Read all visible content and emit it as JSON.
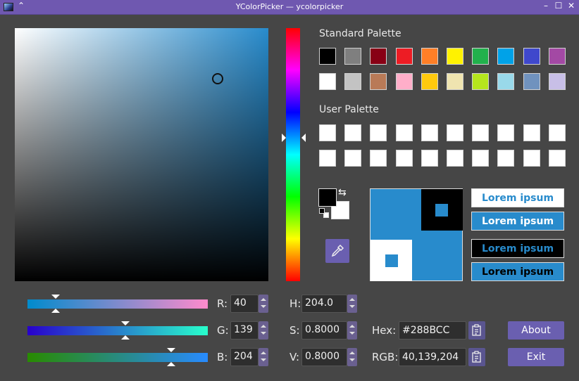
{
  "window": {
    "title": "YColorPicker — ycolorpicker"
  },
  "colors": {
    "current": "#288BCC",
    "accent": "#6a5fb0",
    "titlebar": "#6f58b0"
  },
  "standard_palette": {
    "label": "Standard Palette",
    "swatches": [
      "#000000",
      "#7f7f7f",
      "#880015",
      "#ed1c24",
      "#ff7f27",
      "#fff200",
      "#22b14c",
      "#00a2e8",
      "#3f48cc",
      "#a349a4",
      "#ffffff",
      "#c3c3c3",
      "#b97a57",
      "#ffaec9",
      "#ffc90e",
      "#efe4b0",
      "#b5e61d",
      "#99d9ea",
      "#7092be",
      "#c8bfe7"
    ]
  },
  "user_palette": {
    "label": "User Palette"
  },
  "preview": {
    "lorem": [
      {
        "text": "Lorem ipsum",
        "fg": "#288BCC",
        "bg": "#ffffff"
      },
      {
        "text": "Lorem ipsum",
        "fg": "#ffffff",
        "bg": "#288BCC"
      },
      {
        "text": "Lorem ipsum",
        "fg": "#288BCC",
        "bg": "#000000"
      },
      {
        "text": "Lorem ipsum",
        "fg": "#000000",
        "bg": "#288BCC"
      }
    ]
  },
  "rgb": {
    "r": {
      "label": "R:",
      "value": "40"
    },
    "g": {
      "label": "G:",
      "value": "139"
    },
    "b": {
      "label": "B:",
      "value": "204"
    }
  },
  "hsv": {
    "h": {
      "label": "H:",
      "value": "204.0"
    },
    "s": {
      "label": "S:",
      "value": "0.8000"
    },
    "v": {
      "label": "V:",
      "value": "0.8000"
    }
  },
  "hex": {
    "label": "Hex:",
    "value": "#288BCC"
  },
  "rgb_text": {
    "label": "RGB:",
    "value": "40,139,204"
  },
  "buttons": {
    "about": "About",
    "exit": "Exit"
  },
  "icons": [
    "app-icon",
    "up-arrow-icon",
    "minimize-icon",
    "maximize-icon",
    "close-icon",
    "swap-icon",
    "eyedropper-icon",
    "copy-icon"
  ]
}
